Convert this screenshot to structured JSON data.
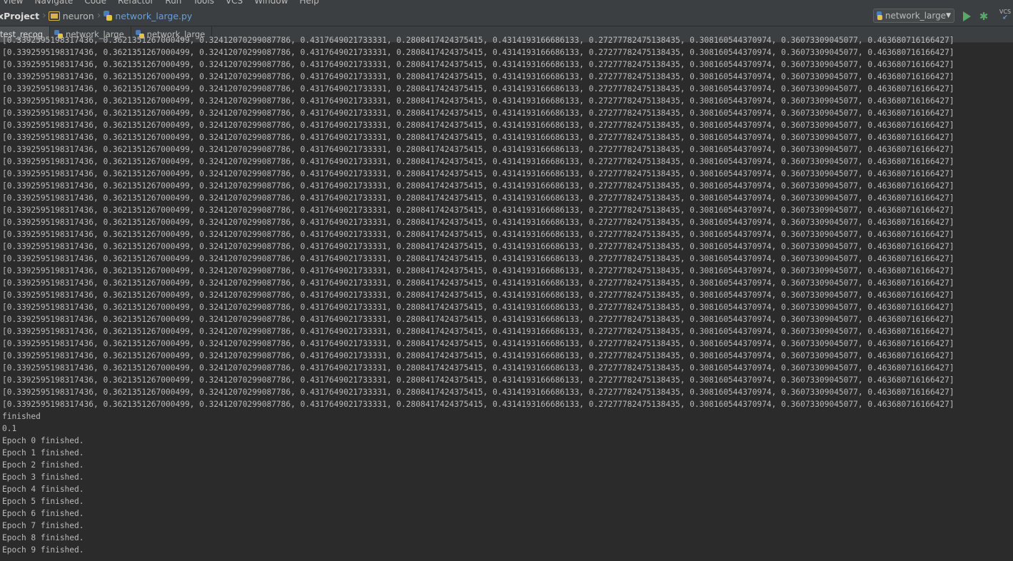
{
  "menu": [
    "View",
    "Navigate",
    "Code",
    "Refactor",
    "Run",
    "Tools",
    "VCS",
    "Window",
    "Help"
  ],
  "breadcrumb": {
    "project": "xProject",
    "folder": "neuron",
    "file": "network_large.py"
  },
  "run_config": {
    "label": "network_large",
    "play_icon": "run-icon",
    "debug_icon": "debug-icon",
    "vcs": "VCS"
  },
  "tabs": [
    {
      "label": "test_recog",
      "active": true
    },
    {
      "label": "network_large",
      "active": false
    },
    {
      "label": "network_large",
      "active": false
    }
  ],
  "console": {
    "repeated_line": "[0.3392595198317436, 0.3621351267000499, 0.32412070299087786, 0.4317649021733331, 0.2808417424375415, 0.4314193166686133, 0.27277782475138435, 0.308160544370974, 0.36073309045077, 0.46368071616642 7]",
    "lines": [
      "[0.3392595198317436, 0.3621351267000499, 0.32412070299087786, 0.4317649021733331, 0.2808417424375415, 0.4314193166686133, 0.27277782475138435, 0.308160544370974, 0.36073309045077, 0.463680716166427]",
      "[0.3392595198317436, 0.3621351267000499, 0.32412070299087786, 0.4317649021733331, 0.2808417424375415, 0.4314193166686133, 0.27277782475138435, 0.308160544370974, 0.36073309045077, 0.463680716166427]",
      "[0.3392595198317436, 0.3621351267000499, 0.32412070299087786, 0.4317649021733331, 0.2808417424375415, 0.4314193166686133, 0.27277782475138435, 0.308160544370974, 0.36073309045077, 0.463680716166427]",
      "[0.3392595198317436, 0.3621351267000499, 0.32412070299087786, 0.4317649021733331, 0.2808417424375415, 0.4314193166686133, 0.27277782475138435, 0.308160544370974, 0.36073309045077, 0.463680716166427]",
      "[0.3392595198317436, 0.3621351267000499, 0.32412070299087786, 0.4317649021733331, 0.2808417424375415, 0.4314193166686133, 0.27277782475138435, 0.308160544370974, 0.36073309045077, 0.463680716166427]",
      "[0.3392595198317436, 0.3621351267000499, 0.32412070299087786, 0.4317649021733331, 0.2808417424375415, 0.4314193166686133, 0.27277782475138435, 0.308160544370974, 0.36073309045077, 0.463680716166427]",
      "[0.3392595198317436, 0.3621351267000499, 0.32412070299087786, 0.4317649021733331, 0.2808417424375415, 0.4314193166686133, 0.27277782475138435, 0.308160544370974, 0.36073309045077, 0.463680716166427]",
      "[0.3392595198317436, 0.3621351267000499, 0.32412070299087786, 0.4317649021733331, 0.2808417424375415, 0.4314193166686133, 0.27277782475138435, 0.308160544370974, 0.36073309045077, 0.463680716166427]",
      "[0.3392595198317436, 0.3621351267000499, 0.32412070299087786, 0.4317649021733331, 0.2808417424375415, 0.4314193166686133, 0.27277782475138435, 0.308160544370974, 0.36073309045077, 0.463680716166427]",
      "[0.3392595198317436, 0.3621351267000499, 0.32412070299087786, 0.4317649021733331, 0.2808417424375415, 0.4314193166686133, 0.27277782475138435, 0.308160544370974, 0.36073309045077, 0.463680716166427]",
      "[0.3392595198317436, 0.3621351267000499, 0.32412070299087786, 0.4317649021733331, 0.2808417424375415, 0.4314193166686133, 0.27277782475138435, 0.308160544370974, 0.36073309045077, 0.463680716166427]",
      "[0.3392595198317436, 0.3621351267000499, 0.32412070299087786, 0.4317649021733331, 0.2808417424375415, 0.4314193166686133, 0.27277782475138435, 0.308160544370974, 0.36073309045077, 0.463680716166427]",
      "[0.3392595198317436, 0.3621351267000499, 0.32412070299087786, 0.4317649021733331, 0.2808417424375415, 0.4314193166686133, 0.27277782475138435, 0.308160544370974, 0.36073309045077, 0.463680716166427]",
      "[0.3392595198317436, 0.3621351267000499, 0.32412070299087786, 0.4317649021733331, 0.2808417424375415, 0.4314193166686133, 0.27277782475138435, 0.308160544370974, 0.36073309045077, 0.463680716166427]",
      "[0.3392595198317436, 0.3621351267000499, 0.32412070299087786, 0.4317649021733331, 0.2808417424375415, 0.4314193166686133, 0.27277782475138435, 0.308160544370974, 0.36073309045077, 0.463680716166427]",
      "[0.3392595198317436, 0.3621351267000499, 0.32412070299087786, 0.4317649021733331, 0.2808417424375415, 0.4314193166686133, 0.27277782475138435, 0.308160544370974, 0.36073309045077, 0.463680716166427]",
      "[0.3392595198317436, 0.3621351267000499, 0.32412070299087786, 0.4317649021733331, 0.2808417424375415, 0.4314193166686133, 0.27277782475138435, 0.308160544370974, 0.36073309045077, 0.463680716166427]",
      "[0.3392595198317436, 0.3621351267000499, 0.32412070299087786, 0.4317649021733331, 0.2808417424375415, 0.4314193166686133, 0.27277782475138435, 0.308160544370974, 0.36073309045077, 0.463680716166427]",
      "[0.3392595198317436, 0.3621351267000499, 0.32412070299087786, 0.4317649021733331, 0.2808417424375415, 0.4314193166686133, 0.27277782475138435, 0.308160544370974, 0.36073309045077, 0.463680716166427]",
      "[0.3392595198317436, 0.3621351267000499, 0.32412070299087786, 0.4317649021733331, 0.2808417424375415, 0.4314193166686133, 0.27277782475138435, 0.308160544370974, 0.36073309045077, 0.463680716166427]",
      "[0.3392595198317436, 0.3621351267000499, 0.32412070299087786, 0.4317649021733331, 0.2808417424375415, 0.4314193166686133, 0.27277782475138435, 0.308160544370974, 0.36073309045077, 0.463680716166427]",
      "[0.3392595198317436, 0.3621351267000499, 0.32412070299087786, 0.4317649021733331, 0.2808417424375415, 0.4314193166686133, 0.27277782475138435, 0.308160544370974, 0.36073309045077, 0.463680716166427]",
      "[0.3392595198317436, 0.3621351267000499, 0.32412070299087786, 0.4317649021733331, 0.2808417424375415, 0.4314193166686133, 0.27277782475138435, 0.308160544370974, 0.36073309045077, 0.463680716166427]",
      "[0.3392595198317436, 0.3621351267000499, 0.32412070299087786, 0.4317649021733331, 0.2808417424375415, 0.4314193166686133, 0.27277782475138435, 0.308160544370974, 0.36073309045077, 0.463680716166427]",
      "[0.3392595198317436, 0.3621351267000499, 0.32412070299087786, 0.4317649021733331, 0.2808417424375415, 0.4314193166686133, 0.27277782475138435, 0.308160544370974, 0.36073309045077, 0.463680716166427]",
      "[0.3392595198317436, 0.3621351267000499, 0.32412070299087786, 0.4317649021733331, 0.2808417424375415, 0.4314193166686133, 0.27277782475138435, 0.308160544370974, 0.36073309045077, 0.463680716166427]",
      "[0.3392595198317436, 0.3621351267000499, 0.32412070299087786, 0.4317649021733331, 0.2808417424375415, 0.4314193166686133, 0.27277782475138435, 0.308160544370974, 0.36073309045077, 0.463680716166427]",
      "[0.3392595198317436, 0.3621351267000499, 0.32412070299087786, 0.4317649021733331, 0.2808417424375415, 0.4314193166686133, 0.27277782475138435, 0.308160544370974, 0.36073309045077, 0.463680716166427]",
      "[0.3392595198317436, 0.3621351267000499, 0.32412070299087786, 0.4317649021733331, 0.2808417424375415, 0.4314193166686133, 0.27277782475138435, 0.308160544370974, 0.36073309045077, 0.463680716166427]",
      "[0.3392595198317436, 0.3621351267000499, 0.32412070299087786, 0.4317649021733331, 0.2808417424375415, 0.4314193166686133, 0.27277782475138435, 0.308160544370974, 0.36073309045077, 0.463680716166427]",
      "[0.3392595198317436, 0.3621351267000499, 0.32412070299087786, 0.4317649021733331, 0.2808417424375415, 0.4314193166686133, 0.27277782475138435, 0.308160544370974, 0.36073309045077, 0.463680716166427]",
      "finished",
      "0.1",
      "Epoch 0 finished.",
      "Epoch 1 finished.",
      "Epoch 2 finished.",
      "Epoch 3 finished.",
      "Epoch 4 finished.",
      "Epoch 5 finished.",
      "Epoch 6 finished.",
      "Epoch 7 finished.",
      "Epoch 8 finished.",
      "Epoch 9 finished."
    ]
  }
}
